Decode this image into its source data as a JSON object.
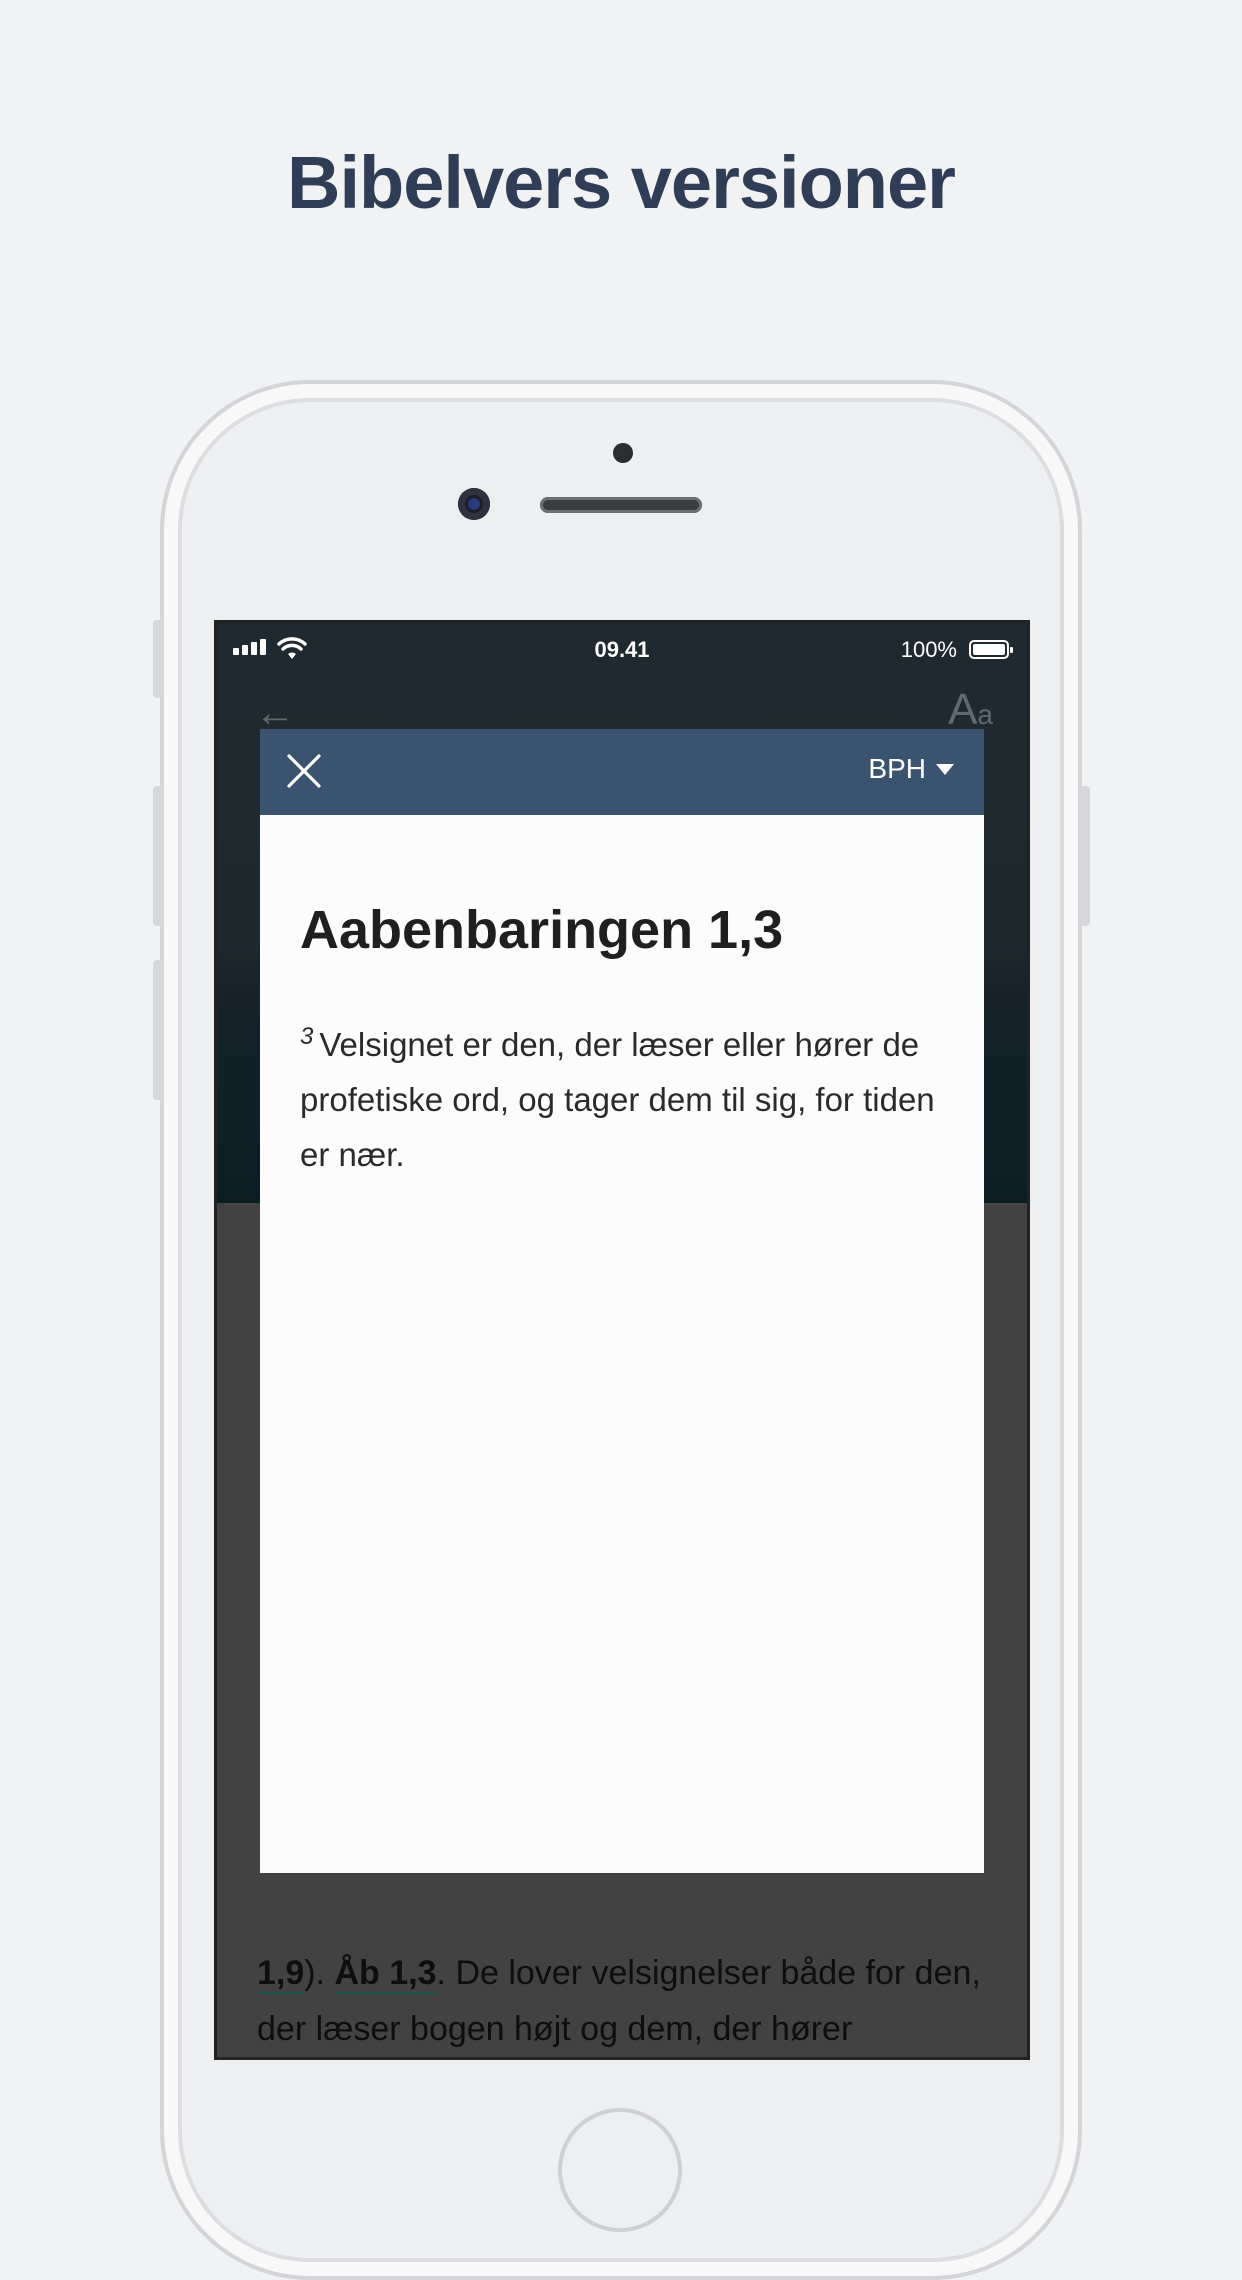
{
  "headline": "Bibelvers versioner",
  "status_bar": {
    "time": "09.41",
    "battery_percent": "100%"
  },
  "toolbar": {
    "back_icon": "arrow-left-icon",
    "font_icon_large": "A",
    "font_icon_small": "a"
  },
  "modal": {
    "close_icon": "close-icon",
    "version": "BPH",
    "title": "Aabenbaringen 1,3",
    "verse_number": "3",
    "verse_text": "Velsignet er den, der læser eller hører de profetiske ord, og tager dem til sig, for tiden er nær."
  },
  "background_text": {
    "ref_tail": "1,9",
    "sep": ").",
    "ref": "Åb 1,3",
    "body": ". De lover velsignelser både for den, der læser bogen højt og dem, der hører"
  },
  "colors": {
    "headline": "#2f3d57",
    "modal_header": "#3a546f",
    "link_underline": "#28776d"
  }
}
